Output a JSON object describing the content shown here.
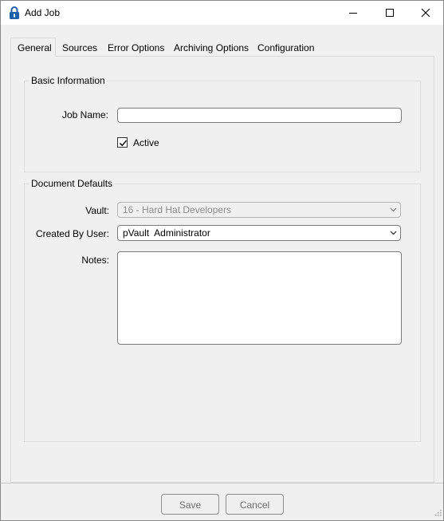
{
  "window": {
    "title": "Add Job",
    "icon": "padlock-icon",
    "controls": [
      "minimize-icon",
      "maximize-icon",
      "close-icon"
    ]
  },
  "tabs": [
    {
      "label": "General",
      "active": true
    },
    {
      "label": "Sources",
      "active": false
    },
    {
      "label": "Error Options",
      "active": false
    },
    {
      "label": "Archiving Options",
      "active": false
    },
    {
      "label": "Configuration",
      "active": false
    }
  ],
  "basic_info": {
    "title": "Basic Information",
    "job_name_label": "Job Name:",
    "job_name_value": "",
    "active_label": "Active",
    "active_checked": true
  },
  "doc_defaults": {
    "title": "Document Defaults",
    "vault_label": "Vault:",
    "vault_value": "16 - Hard Hat Developers",
    "vault_disabled": true,
    "created_by_label": "Created By User:",
    "created_by_value": "pVault  Administrator",
    "notes_label": "Notes:",
    "notes_value": ""
  },
  "buttons": {
    "save": "Save",
    "cancel": "Cancel"
  },
  "colors": {
    "window_bg": "#f0f0f0",
    "titlebar_bg": "#ffffff",
    "icon_blue": "#1f5fa8"
  }
}
